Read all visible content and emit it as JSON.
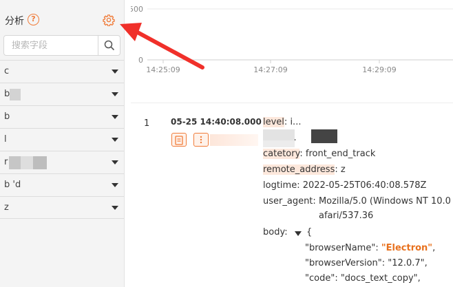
{
  "sidebar": {
    "title": "分析",
    "help_icon": "question-circle-icon",
    "settings_icon": "gear-icon",
    "search_placeholder": "搜索字段",
    "fields": [
      {
        "label": "c"
      },
      {
        "label": "b"
      },
      {
        "label": "b"
      },
      {
        "label": "l"
      },
      {
        "label": "r"
      },
      {
        "label": "b           'd"
      },
      {
        "label": "z"
      }
    ]
  },
  "chart": {
    "yticks": [
      "500",
      "0"
    ],
    "xticks": [
      "14:25:09",
      "14:27:09",
      "14:29:09"
    ]
  },
  "record": {
    "index": "1",
    "time": "05-25 14:40:08.000",
    "fields": {
      "level_key": "level",
      "level_val": " i...",
      "msg_key": "msg",
      "msg_val": " ...",
      "catetory_key": "catetory",
      "catetory_val": "front_end_track",
      "remote_key": "remote_address",
      "remote_val": "z",
      "logtime_key": "logtime",
      "logtime_val": "2022-05-25T06:40:08.578Z",
      "ua_key": "user_agent",
      "ua_val": "Mozilla/5.0 (Windows NT 10.0",
      "ua_val2": "afari/537.36",
      "body_key": "body"
    },
    "body": {
      "open_brace": "{",
      "l1_key": "\"browserName\"",
      "l1_val": "\"Electron\"",
      "l2_key": "\"browserVersion\"",
      "l2_val": "\"12.0.7\"",
      "l3_key": "\"code\"",
      "l3_val": "\"docs_text_copy\""
    }
  },
  "colors": {
    "accent": "#f07c3a",
    "arrow": "#f0302a"
  }
}
